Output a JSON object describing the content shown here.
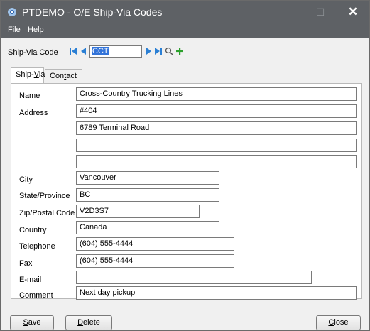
{
  "window": {
    "title": "PTDEMO - O/E Ship-Via Codes",
    "minimize_glyph": "–",
    "maximize_glyph": "☐",
    "close_glyph": "✕"
  },
  "menu": {
    "file": {
      "mnemonic": "F",
      "rest": "ile"
    },
    "help": {
      "mnemonic": "H",
      "rest": "elp"
    }
  },
  "lookup": {
    "label": "Ship-Via Code",
    "value": "CCT",
    "icons": [
      "first-record-icon",
      "previous-record-icon",
      "next-record-icon",
      "last-record-icon",
      "search-icon",
      "add-icon"
    ]
  },
  "tabs": {
    "shipvia": {
      "pre": "Ship-",
      "mnemonic": "V",
      "post": "ia"
    },
    "contact": {
      "pre": "Con",
      "mnemonic": "t",
      "post": "act"
    }
  },
  "form": {
    "name_label": "Name",
    "name_value": "Cross-Country Trucking Lines",
    "address_label": "Address",
    "address_1": "#404",
    "address_2": "6789 Terminal Road",
    "address_3": "",
    "address_4": "",
    "city_label": "City",
    "city_value": "Vancouver",
    "state_label": "State/Province",
    "state_value": "BC",
    "zip_label": "Zip/Postal Code",
    "zip_value": "V2D3S7",
    "country_label": "Country",
    "country_value": "Canada",
    "telephone_label": "Telephone",
    "telephone_value": "(604) 555-4444",
    "fax_label": "Fax",
    "fax_value": "(604) 555-4444",
    "email_label": "E-mail",
    "email_value": "",
    "comment_label": "Comment",
    "comment_value": "Next day pickup"
  },
  "buttons": {
    "save": {
      "mnemonic": "S",
      "rest": "ave"
    },
    "delete": {
      "mnemonic": "D",
      "rest": "elete"
    },
    "close": {
      "mnemonic": "C",
      "rest": "lose"
    }
  },
  "colors": {
    "titlebar": "#5e6165",
    "nav_arrow": "#2a7fd4",
    "add_icon": "#2ca02c",
    "selection": "#3374d9"
  }
}
